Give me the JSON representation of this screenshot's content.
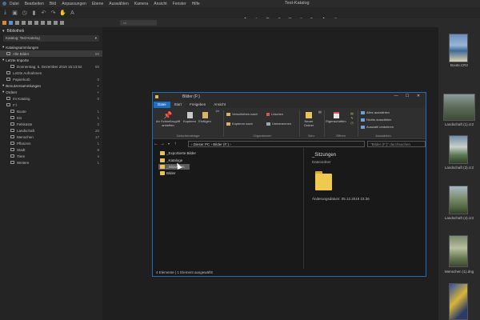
{
  "app": {
    "window_title": "Test-Katalog",
    "menu": [
      "Datei",
      "Bearbeiten",
      "Bild",
      "Anpassungen",
      "Ebene",
      "Auswählen",
      "Kamera",
      "Ansicht",
      "Fenster",
      "Hilfe"
    ]
  },
  "library": {
    "header": "Bibliothek",
    "catalog_select": "Katalog: Test-Katalog",
    "tree": [
      {
        "label": "Katalogsammlungen",
        "count": "",
        "indent": 0,
        "group": true
      },
      {
        "label": "Alle Bilder",
        "count": "60",
        "indent": 1,
        "selected": true
      },
      {
        "label": "Letzte Importe",
        "count": "",
        "indent": 0,
        "group": true
      },
      {
        "label": "Donnerstag, 5. Dezember 2019 15:13:52",
        "count": "60",
        "indent": 2
      },
      {
        "label": "Letzte Aufnahmen",
        "count": "",
        "indent": 1
      },
      {
        "label": "Papierkorb",
        "count": "0",
        "indent": 1
      },
      {
        "label": "Benutzersammlungen",
        "count": "",
        "indent": 0,
        "group": true,
        "plus": true
      },
      {
        "label": "Ordner",
        "count": "",
        "indent": 0,
        "group": true,
        "plus": true
      },
      {
        "label": "Im Katalog",
        "count": "0",
        "indent": 1
      },
      {
        "label": "F:\\",
        "count": "",
        "indent": 1
      },
      {
        "label": "Boote",
        "count": "1",
        "indent": 2
      },
      {
        "label": "Eis",
        "count": "1",
        "indent": 2
      },
      {
        "label": "Felsküste",
        "count": "2",
        "indent": 2
      },
      {
        "label": "Landschaft",
        "count": "20",
        "indent": 2
      },
      {
        "label": "Menschen",
        "count": "17",
        "indent": 2
      },
      {
        "label": "Pflanzen",
        "count": "1",
        "indent": 2
      },
      {
        "label": "Stadt",
        "count": "8",
        "indent": 2
      },
      {
        "label": "Tiere",
        "count": "4",
        "indent": 2
      },
      {
        "label": "Weitere",
        "count": "1",
        "indent": 2
      }
    ]
  },
  "filmstrip": {
    "labels": [
      "Boote.CR2",
      "Landschaft (1).cr2",
      "Landschaft (3).cr2",
      "Landschaft (4).cr2",
      "Menschen (1).dng",
      ""
    ]
  },
  "explorer": {
    "title": "Bilder (F:)",
    "window_controls": [
      "—",
      "☐",
      "✕"
    ],
    "ribbon_tabs": [
      "Datei",
      "Start",
      "Freigeben",
      "Ansicht"
    ],
    "ribbon": {
      "pin": "An Schnellzugriff anheften",
      "copy": "Kopieren",
      "paste": "Einfügen",
      "move_to": "Verschieben nach",
      "copy_to": "Kopieren nach",
      "delete": "Löschen",
      "rename": "Umbenennen",
      "new_folder": "Neuer Ordner",
      "properties": "Eigenschaften",
      "select_all": "Alles auswählen",
      "select_none": "Nichts auswählen",
      "invert": "Auswahl umkehren",
      "groups": [
        "Zwischenablage",
        "Organisieren",
        "Neu",
        "Öffnen",
        "Auswählen"
      ]
    },
    "address": "›  Dieser PC  ›  Bilder (F:)  ›",
    "search_placeholder": "\"Bilder (F:)\" durchsuchen",
    "nav_items": [
      "_Exportierte Bilder",
      "_Kataloge",
      "_Sitzungen",
      "Bilder"
    ],
    "content": {
      "folder_name": "_Sitzungen",
      "folder_type": "Dateiordner",
      "modified": "Änderungsdatum: 05.12.2019 15:36"
    },
    "status": "4 Elemente  |  1 Element ausgewählt"
  }
}
